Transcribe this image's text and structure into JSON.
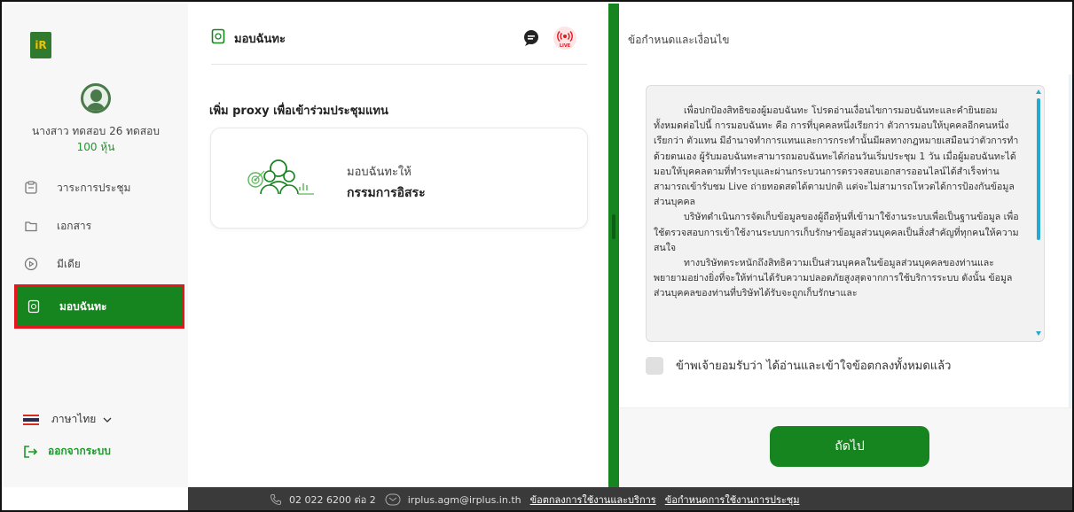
{
  "logo": {
    "text": "iR"
  },
  "user": {
    "name": "นางสาว ทดสอบ 26 ทดสอบ",
    "shares": "100 หุ้น"
  },
  "sidebar": {
    "items": [
      {
        "label": "วาระการประชุม",
        "icon": "agenda-icon"
      },
      {
        "label": "เอกสาร",
        "icon": "folder-icon"
      },
      {
        "label": "มีเดีย",
        "icon": "play-icon"
      },
      {
        "label": "มอบฉันทะ",
        "icon": "proxy-doc-icon",
        "active": true
      }
    ],
    "language": "ภาษาไทย",
    "logout": "ออกจากระบบ"
  },
  "middle": {
    "title": "มอบฉันทะ",
    "live_badge": "LIVE",
    "heading": "เพิ่ม proxy เพื่อเข้าร่วมประชุมแทน",
    "card": {
      "label": "มอบฉันทะให้",
      "value": "กรรมการอิสระ"
    }
  },
  "terms": {
    "title": "ข้อกำหนดและเงื่อนไข",
    "paragraphs": [
      "เพื่อปกป้องสิทธิของผู้มอบฉันทะ โปรดอ่านเงื่อนไขการมอบฉันทะและคำยินยอมทั้งหมดต่อไปนี้ การมอบฉันทะ คือ การที่บุคคลหนึ่งเรียกว่า ตัวการมอบให้บุคคลอีกคนหนึ่ง เรียกว่า ตัวแทน มีอำนาจทำการแทนและการกระทำนั้นมีผลทางกฎหมายเสมือนว่าตัวการทำด้วยตนเอง ผู้รับมอบฉันทะสามารถมอบฉันทะได้ก่อนวันเริ่มประชุม 1 วัน เมื่อผู้มอบฉันทะได้มอบให้บุคคลตามที่ทำระบุและผ่านกระบวนการตรวจสอบเอกสารออนไลน์ได้สำเร็จท่านสามารถเข้ารับชม Live ถ่ายทอดสดได้ตามปกติ แต่จะไม่สามารถโหวตได้การป้องกันข้อมูลส่วนบุคคล",
      "บริษัทดำเนินการจัดเก็บข้อมูลของผู้ถือหุ้นที่เข้ามาใช้งานระบบเพื่อเป็นฐานข้อมูล เพื่อใช้ตรวจสอบการเข้าใช้งานระบบการเก็บรักษาข้อมูลส่วนบุคคลเป็นสิ่งสำคัญที่ทุกคนให้ความสนใจ",
      "ทางบริษัทตระหนักถึงสิทธิความเป็นส่วนบุคคลในข้อมูลส่วนบุคคลของท่านและพยายามอย่างยิ่งที่จะให้ท่านได้รับความปลอดภัยสูงสุดจากการใช้บริการระบบ ดังนั้น ข้อมูลส่วนบุคคลของท่านที่บริษัทได้รับจะถูกเก็บรักษาและ"
    ],
    "agree_label": "ข้าพเจ้ายอมรับว่า ได้อ่านและเข้าใจข้อตกลงทั้งหมดแล้ว",
    "next_button": "ถัดไป"
  },
  "footer": {
    "phone": "02 022 6200 ต่อ 2",
    "email": "irplus.agm@irplus.in.th",
    "link1": "ข้อตกลงการใช้งานและบริการ",
    "link2": "ข้อกำหนดการใช้งานการประชุม"
  },
  "colors": {
    "accent": "#16851f",
    "highlight": "#e6161f",
    "footer": "#3a3a3a",
    "scroll": "#27a8cf"
  }
}
